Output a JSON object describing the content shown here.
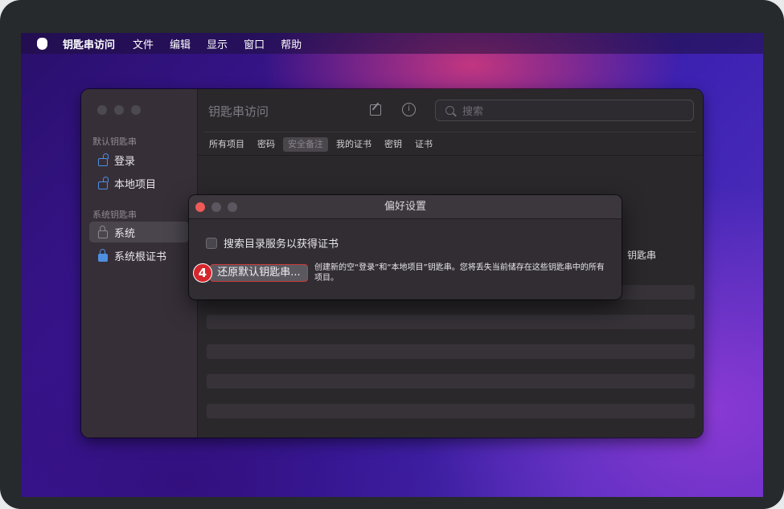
{
  "menubar": {
    "app_name": "钥匙串访问",
    "items": [
      "文件",
      "编辑",
      "显示",
      "窗口",
      "帮助"
    ]
  },
  "window": {
    "title": "钥匙串访问",
    "search_placeholder": "搜索",
    "info_glyph": "i",
    "sidebar": {
      "default_section": "默认钥匙串",
      "default_items": [
        {
          "label": "登录",
          "icon": "unlocked-lock-icon"
        },
        {
          "label": "本地项目",
          "icon": "unlocked-lock-icon"
        }
      ],
      "system_section": "系统钥匙串",
      "system_items": [
        {
          "label": "系统",
          "icon": "lock-icon",
          "selected": true
        },
        {
          "label": "系统根证书",
          "icon": "certificate-lock-icon"
        }
      ]
    },
    "tabs": [
      "所有项目",
      "密码",
      "安全备注",
      "我的证书",
      "密钥",
      "证书"
    ],
    "selected_tab": "安全备注",
    "column_header": "钥匙串"
  },
  "preferences": {
    "title": "偏好设置",
    "checkbox_label": "搜索目录服务以获得证书",
    "checkbox_checked": false,
    "reset_button": "还原默认钥匙串...",
    "reset_description": "创建新的空“登录”和“本地项目”钥匙串。您将丢失当前储存在这些钥匙串中的所有项目。",
    "step_badge": "4"
  },
  "colors": {
    "accent_blue": "#4f8fe0",
    "badge_red": "#d6272d",
    "traffic_red": "#ee5b56",
    "traffic_gray": "#5b5760"
  }
}
